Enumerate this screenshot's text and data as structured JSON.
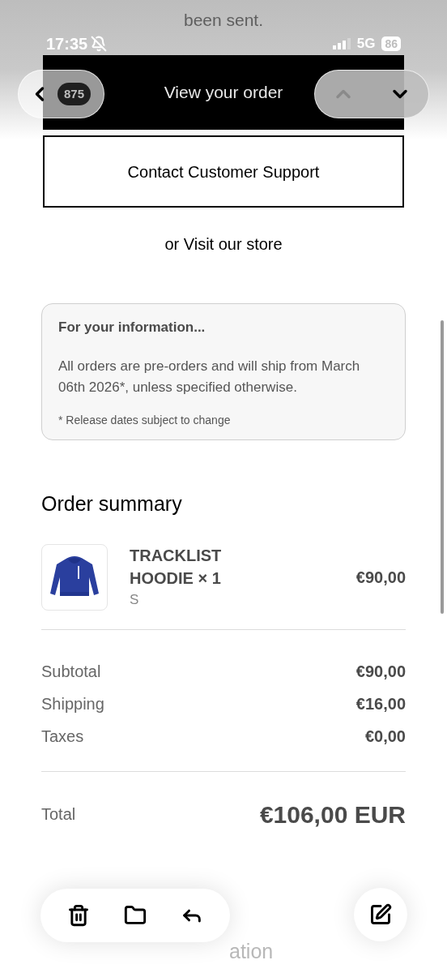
{
  "behind_text": "been sent.",
  "status_bar": {
    "time": "17:35",
    "network": "5G",
    "battery": "86"
  },
  "nav": {
    "title": "View your order",
    "count": "875"
  },
  "support_button": "Contact Customer Support",
  "store_link": "or Visit our store",
  "info": {
    "title": "For your information...",
    "body": "All orders are pre-orders and will ship from March 06th 2026*, unless specified otherwise.",
    "note": "* Release dates subject to change"
  },
  "summary": {
    "title": "Order summary",
    "items": [
      {
        "name": "TRACKLIST HOODIE × 1",
        "variant": "S",
        "price": "€90,00"
      }
    ],
    "lines": [
      {
        "label": "Subtotal",
        "value": "€90,00"
      },
      {
        "label": "Shipping",
        "value": "€16,00"
      },
      {
        "label": "Taxes",
        "value": "€0,00"
      }
    ],
    "total": {
      "label": "Total",
      "value": "€106,00 EUR"
    }
  },
  "next_heading": "ation"
}
